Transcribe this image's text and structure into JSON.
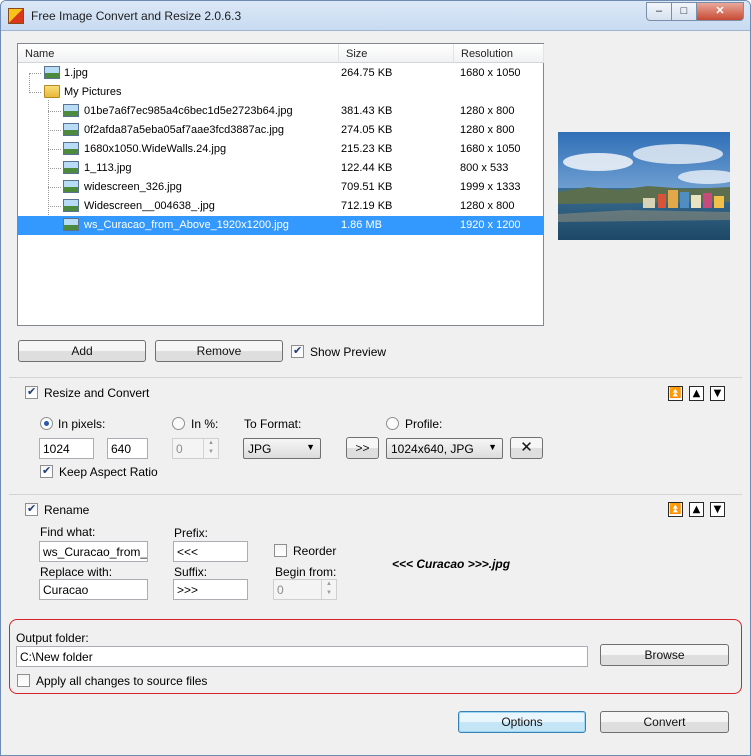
{
  "window": {
    "title": "Free Image Convert and Resize 2.0.6.3",
    "controls": {
      "minimize": "–",
      "maximize": "□",
      "close": "✕"
    }
  },
  "file_list": {
    "columns": [
      "Name",
      "Size",
      "Resolution"
    ],
    "rows": [
      {
        "name": "1.jpg",
        "size": "264.75 KB",
        "resolution": "1680 x 1050",
        "kind": "image",
        "level": 1
      },
      {
        "name": "My Pictures",
        "size": "",
        "resolution": "",
        "kind": "folder",
        "level": 1
      },
      {
        "name": "01be7a6f7ec985a4c6bec1d5e2723b64.jpg",
        "size": "381.43 KB",
        "resolution": "1280 x 800",
        "kind": "image",
        "level": 2
      },
      {
        "name": "0f2afda87a5eba05af7aae3fcd3887ac.jpg",
        "size": "274.05 KB",
        "resolution": "1280 x 800",
        "kind": "image",
        "level": 2
      },
      {
        "name": "1680x1050.WideWalls.24.jpg",
        "size": "215.23 KB",
        "resolution": "1680 x 1050",
        "kind": "image",
        "level": 2
      },
      {
        "name": "1_113.jpg",
        "size": "122.44 KB",
        "resolution": "800 x 533",
        "kind": "image",
        "level": 2
      },
      {
        "name": "widescreen_326.jpg",
        "size": "709.51 KB",
        "resolution": "1999 x 1333",
        "kind": "image",
        "level": 2
      },
      {
        "name": "Widescreen__004638_.jpg",
        "size": "712.19 KB",
        "resolution": "1280 x 800",
        "kind": "image",
        "level": 2
      },
      {
        "name": "ws_Curacao_from_Above_1920x1200.jpg",
        "size": "1.86 MB",
        "resolution": "1920 x 1200",
        "kind": "image",
        "level": 2,
        "selected": true
      }
    ]
  },
  "list_buttons": {
    "add": "Add",
    "remove": "Remove",
    "show_preview": "Show Preview",
    "show_preview_checked": true
  },
  "resize": {
    "title": "Resize and Convert",
    "enabled": true,
    "in_pixels": "In pixels:",
    "in_percent": "In %:",
    "to_format": "To Format:",
    "profile": "Profile:",
    "width": "1024",
    "height": "640",
    "percent": "0",
    "format": "JPG",
    "apply_profile": ">>",
    "profile_value": "1024x640, JPG",
    "keep_aspect": "Keep Aspect Ratio",
    "keep_aspect_checked": true,
    "mode": "pixels"
  },
  "rename": {
    "title": "Rename",
    "enabled": true,
    "find_what": "Find what:",
    "find_value": "ws_Curacao_from_Ab",
    "replace_with": "Replace with:",
    "replace_value": "Curacao",
    "prefix": "Prefix:",
    "prefix_value": "<<<",
    "suffix": "Suffix:",
    "suffix_value": ">>>",
    "reorder": "Reorder",
    "reorder_checked": false,
    "begin_from": "Begin from:",
    "begin_value": "0",
    "result": "<<< Curacao >>>.jpg"
  },
  "output": {
    "label": "Output folder:",
    "path": "C:\\New folder",
    "browse": "Browse",
    "apply_all": "Apply all changes to source files",
    "apply_all_checked": false
  },
  "footer": {
    "options": "Options",
    "convert": "Convert"
  },
  "section_controls": {
    "move_top": "⏫",
    "move_up": "▲",
    "move_down": "▼"
  }
}
